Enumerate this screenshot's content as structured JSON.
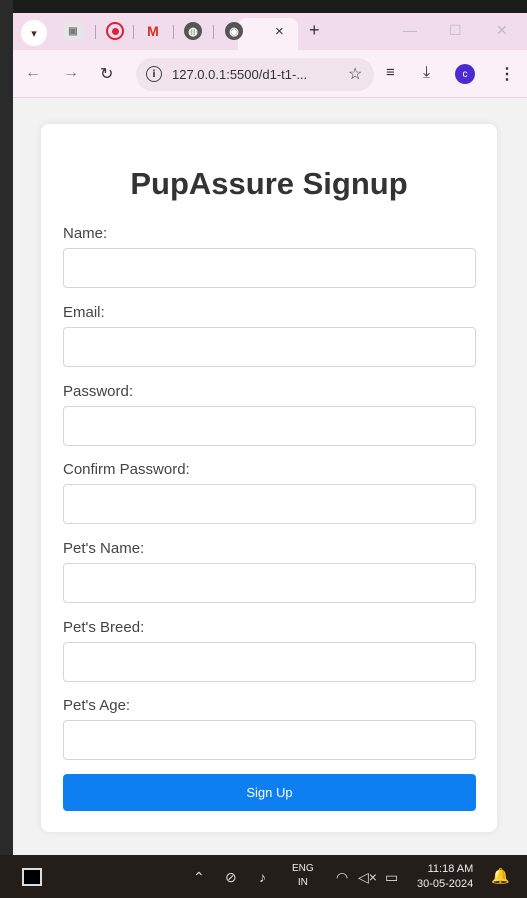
{
  "browser": {
    "tabs": [
      {
        "icon": "generic-page-icon"
      },
      {
        "icon": "record-icon"
      },
      {
        "icon": "gmail-icon",
        "glyph": "M"
      },
      {
        "icon": "globe-icon"
      },
      {
        "icon": "chrome-icon"
      }
    ],
    "tab_close": "×",
    "new_tab": "+",
    "url": "127.0.0.1:5500/d1-t1-...",
    "profile_initial": "c",
    "accent": "#4a2bd1"
  },
  "form": {
    "title": "PupAssure Signup",
    "fields": [
      {
        "label": "Name:",
        "value": ""
      },
      {
        "label": "Email:",
        "value": ""
      },
      {
        "label": "Password:",
        "value": ""
      },
      {
        "label": "Confirm Password:",
        "value": ""
      },
      {
        "label": "Pet's Name:",
        "value": ""
      },
      {
        "label": "Pet's Breed:",
        "value": ""
      },
      {
        "label": "Pet's Age:",
        "value": ""
      }
    ],
    "submit_label": "Sign Up",
    "submit_color": "#0d7ff0"
  },
  "taskbar": {
    "language_line1": "ENG",
    "language_line2": "IN",
    "time": "11:18 AM",
    "date": "30-05-2024"
  }
}
